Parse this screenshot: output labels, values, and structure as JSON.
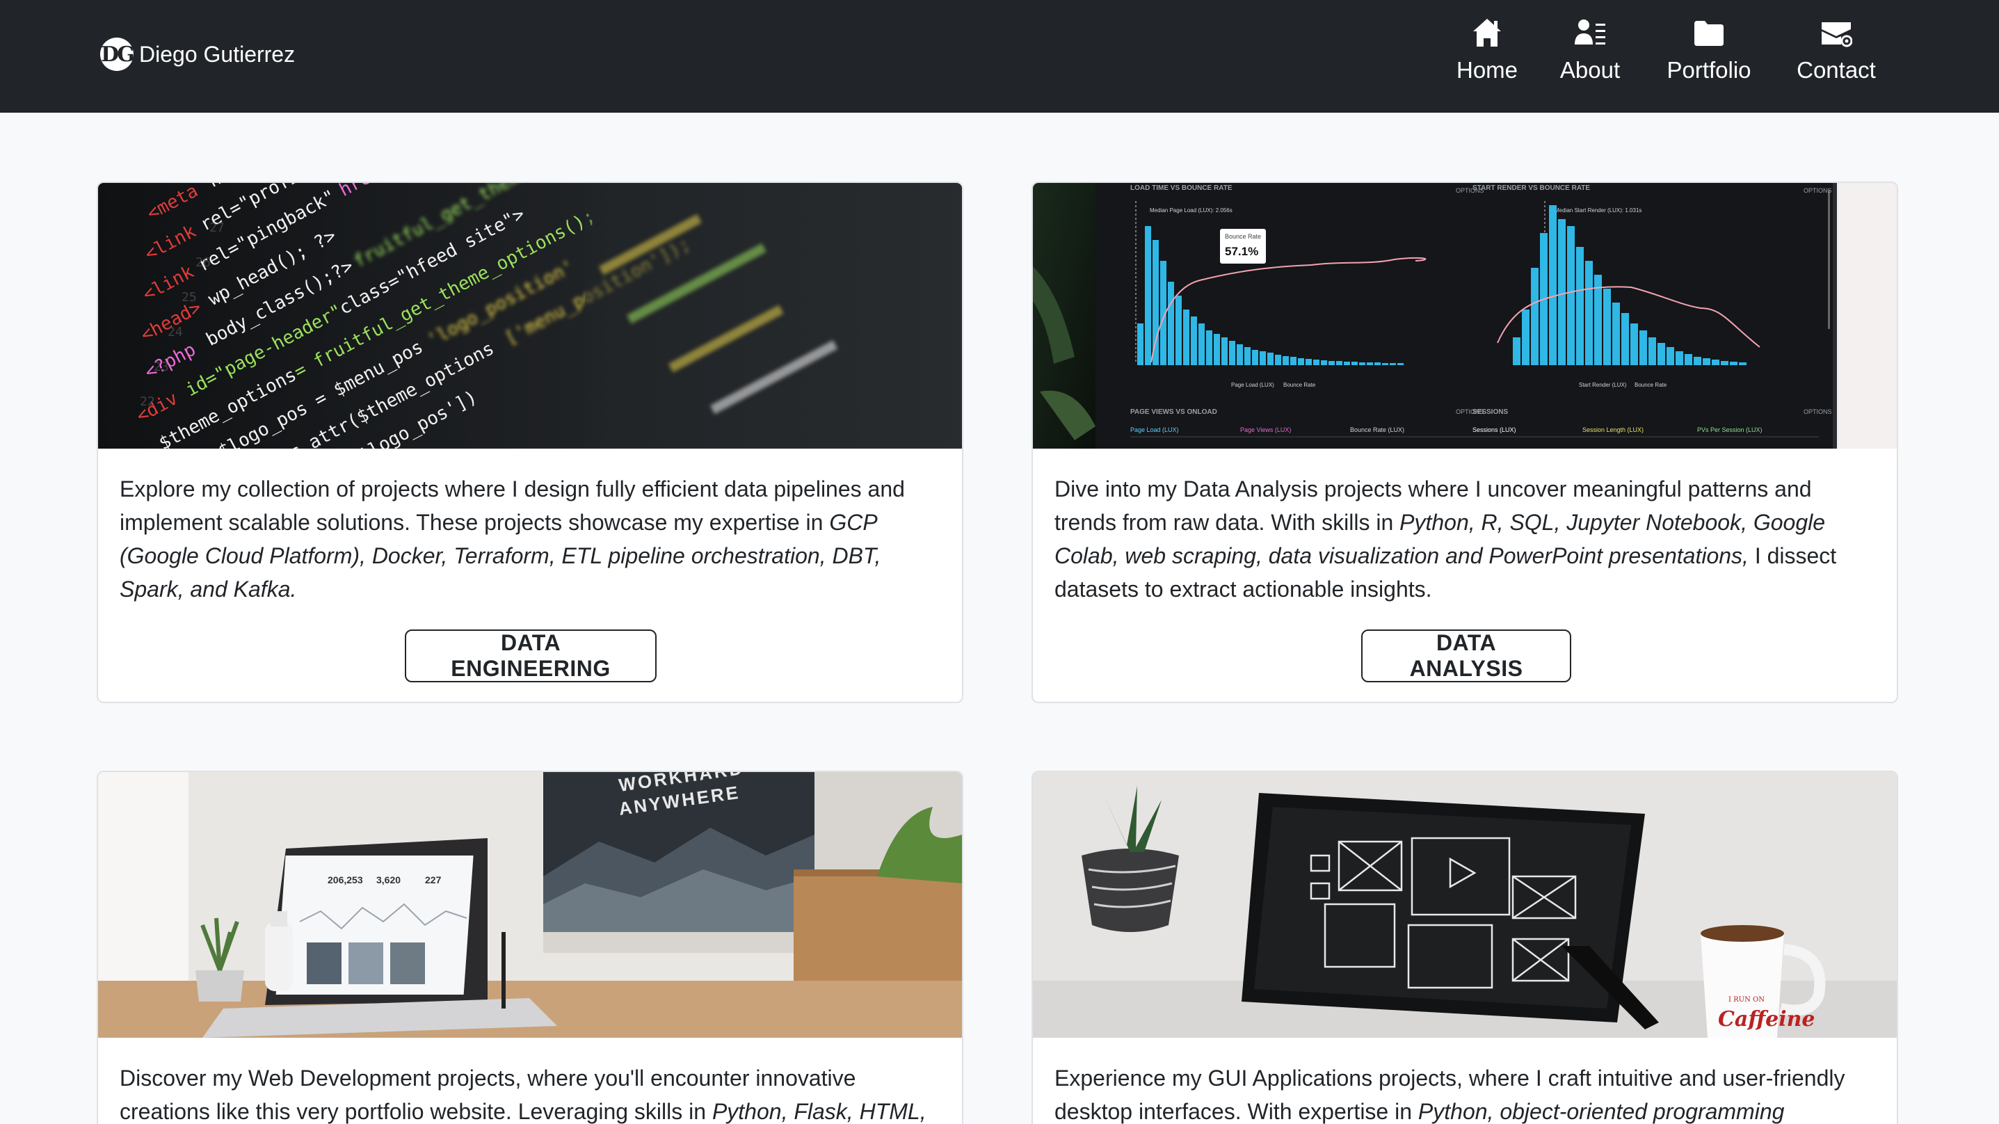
{
  "brand": {
    "logo": "DG",
    "name": "Diego Gutierrez"
  },
  "nav": [
    {
      "label": "Home",
      "icon": "home-icon"
    },
    {
      "label": "About",
      "icon": "person-lines-icon"
    },
    {
      "label": "Portfolio",
      "icon": "folder-icon"
    },
    {
      "label": "Contact",
      "icon": "envelope-at-icon"
    }
  ],
  "cards": [
    {
      "image": "code-editor-photo",
      "text_plain": "Explore my collection of projects where I design fully efficient data pipelines and implement scalable solutions. These projects showcase my expertise in ",
      "text_em": "GCP (Google Cloud Platform), Docker, Terraform, ETL pipeline orchestration, DBT, Spark, and Kafka.",
      "text_tail": "",
      "button": "DATA ENGINEERING"
    },
    {
      "image": "analytics-dashboard-photo",
      "text_plain": "Dive into my Data Analysis projects where I uncover meaningful patterns and trends from raw data. With skills in ",
      "text_em": "Python, R, SQL, Jupyter Notebook, Google Colab, web scraping, data visualization and PowerPoint presentations,",
      "text_tail": " I dissect datasets to extract actionable insights.",
      "button": "DATA ANALYSIS"
    },
    {
      "image": "laptop-desk-photo",
      "text_plain": "Discover my Web Development projects, where you'll encounter innovative creations like this very portfolio website. Leveraging skills in ",
      "text_em": "Python, Flask, HTML,",
      "text_tail": ""
    },
    {
      "image": "tablet-wireframe-photo",
      "text_plain": "Experience my GUI Applications projects, where I craft intuitive and user-friendly desktop interfaces. With expertise in ",
      "text_em": "Python, object-oriented programming",
      "text_tail": ""
    }
  ],
  "dashboard_photo": {
    "panel1_title": "LOAD TIME VS BOUNCE RATE",
    "panel2_title": "START RENDER VS BOUNCE RATE",
    "options": "OPTIONS",
    "callout_label": "Bounce Rate",
    "callout_value": "57.1%",
    "median1": "Median Page Load (LUX): 2.056s",
    "median2": "Median Start Render (LUX): 1.031s",
    "legend1a": "Page Load (LUX)",
    "legend1b": "Bounce Rate",
    "legend2a": "Start Render (LUX)",
    "legend2b": "Bounce Rate",
    "panel3_title": "PAGE VIEWS VS ONLOAD",
    "panel4_title": "SESSIONS",
    "bottom_labels": [
      "Page Load (LUX)",
      "Page Views (LUX)",
      "Bounce Rate (LUX)",
      "Sessions (LUX)",
      "Session Length (LUX)",
      "PVs Per Session (LUX)"
    ]
  },
  "laptop_photo": {
    "poster_line1": "WORKHARD",
    "poster_line2": "ANYWHERE",
    "stats": [
      "206,253",
      "3,620",
      "227"
    ]
  },
  "mug_photo": {
    "mug_small": "I RUN ON",
    "mug_big": "Caffeine"
  },
  "colors": {
    "navbar": "#212529",
    "page_bg": "#f8f9fa",
    "accent_chart": "#2fb7e6"
  }
}
